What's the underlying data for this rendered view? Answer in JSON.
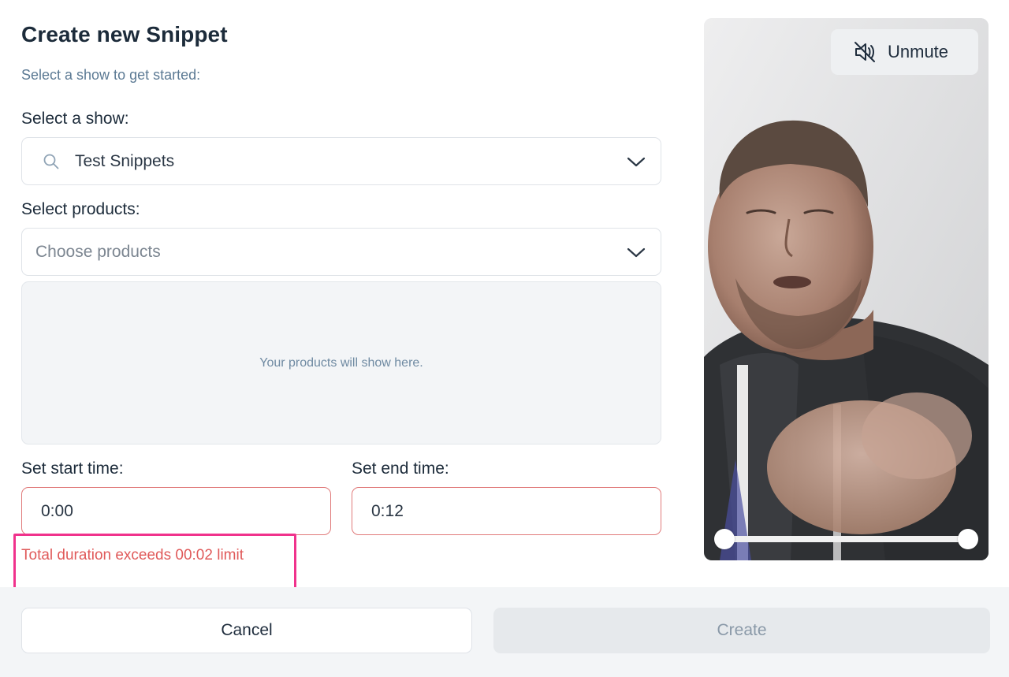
{
  "modal": {
    "title": "Create new Snippet",
    "subtitle": "Select a show to get started:"
  },
  "show": {
    "label": "Select a show:",
    "value": "Test Snippets",
    "icon": "search-icon"
  },
  "products": {
    "label": "Select products:",
    "placeholder": "Choose products",
    "empty_text": "Your products will show here."
  },
  "start_time": {
    "label": "Set start time:",
    "value": "0:00"
  },
  "end_time": {
    "label": "Set end time:",
    "value": "0:12"
  },
  "error": {
    "message": "Total duration exceeds 00:02 limit",
    "color": "#e05a5a"
  },
  "video": {
    "unmute_label": "Unmute",
    "unmute_icon": "speaker-muted-icon"
  },
  "footer": {
    "cancel_label": "Cancel",
    "create_label": "Create"
  }
}
